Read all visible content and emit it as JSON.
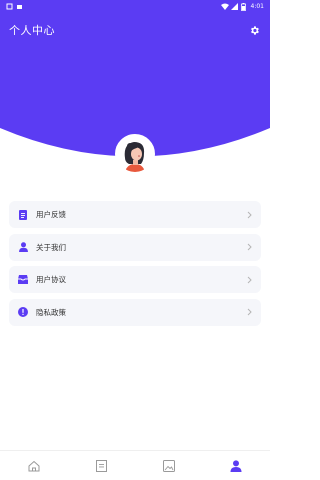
{
  "status_bar": {
    "time": "4:01"
  },
  "header": {
    "title": "个人中心"
  },
  "menu": [
    {
      "label": "用户反馈",
      "icon": "document-icon"
    },
    {
      "label": "关于我们",
      "icon": "person-icon"
    },
    {
      "label": "用户协议",
      "icon": "inbox-icon"
    },
    {
      "label": "隐私政策",
      "icon": "alert-icon"
    }
  ],
  "tabs": [
    {
      "name": "home",
      "icon": "home-icon",
      "active": false
    },
    {
      "name": "notes",
      "icon": "note-icon",
      "active": false
    },
    {
      "name": "gallery",
      "icon": "image-icon",
      "active": false
    },
    {
      "name": "profile",
      "icon": "person-icon",
      "active": true
    }
  ],
  "colors": {
    "brand": "#5b3cf3",
    "inactive_icon": "#9a9a9a",
    "menu_bg": "#f5f6fa"
  }
}
